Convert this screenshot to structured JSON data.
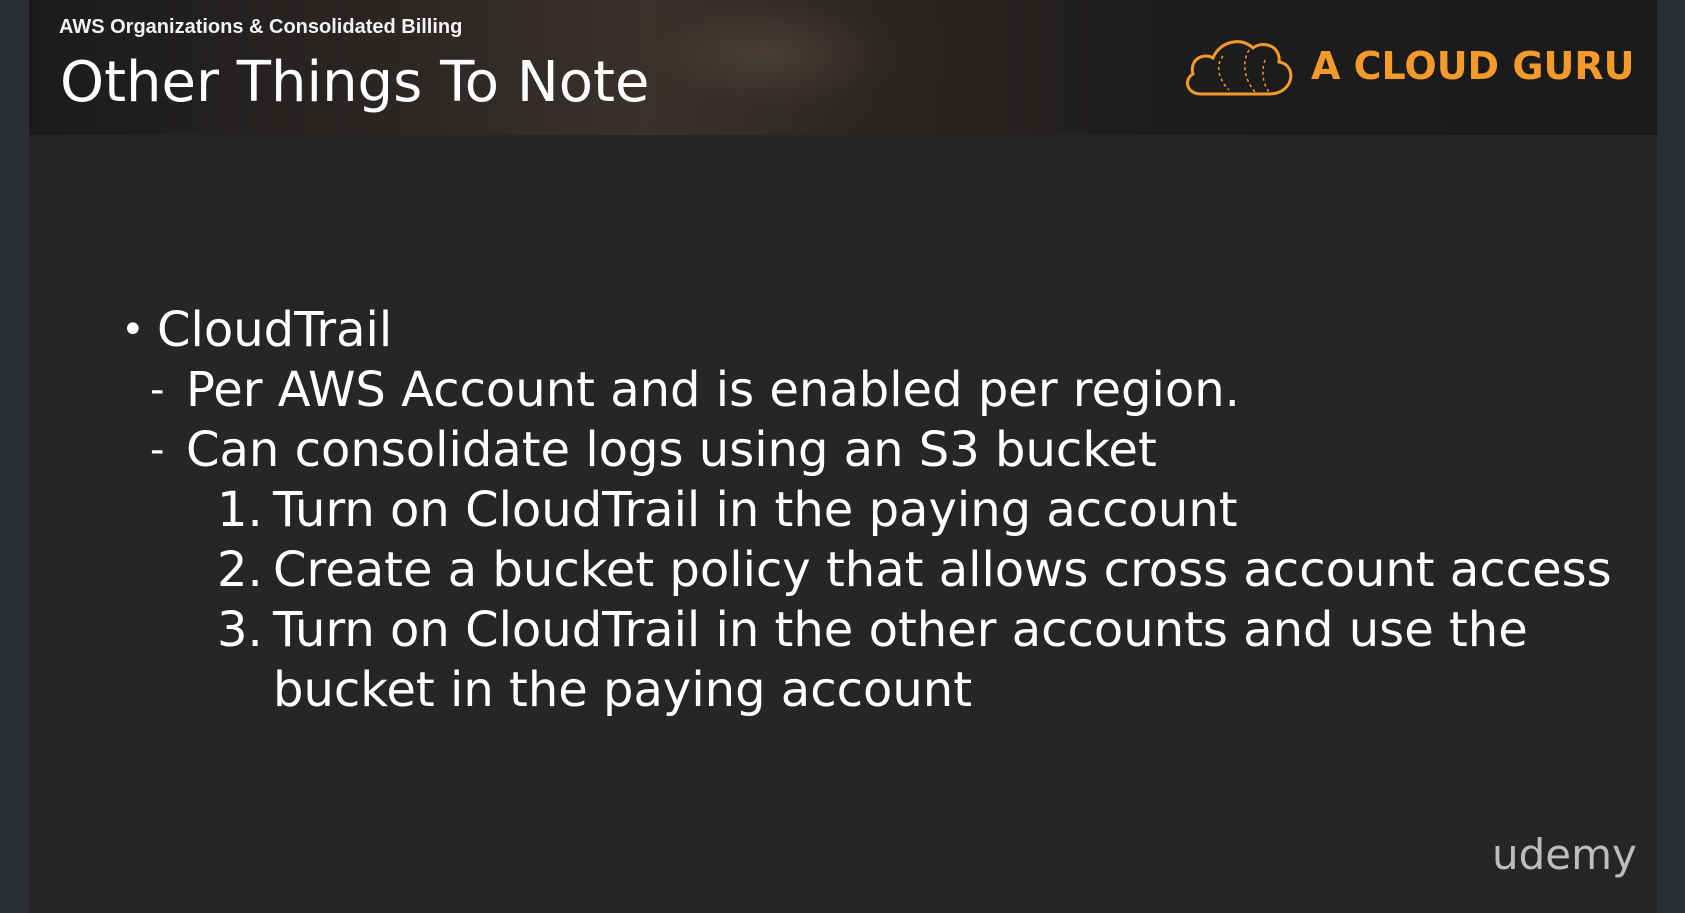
{
  "header": {
    "subtitle": "AWS Organizations & Consolidated Billing",
    "title": "Other Things To Note",
    "logo_text": "A CLOUD GURU",
    "logo_icon": "cloud-icon",
    "logo_color": "#f49a2a"
  },
  "body": {
    "bullet_marker": "•",
    "bullet": "CloudTrail",
    "dash_marker": "-",
    "sub_items": [
      "Per AWS Account and is enabled per region.",
      "Can consolidate logs using an S3 bucket"
    ],
    "steps": [
      {
        "num": "1.",
        "text": "Turn on CloudTrail in the paying account"
      },
      {
        "num": "2.",
        "text": "Create a bucket policy that allows cross account access"
      },
      {
        "num": "3.",
        "text": "Turn on CloudTrail in the other accounts and use the",
        "continuation": "bucket in the paying account"
      }
    ]
  },
  "watermark": "udemy",
  "colors": {
    "background": "#262626",
    "text": "#ffffff",
    "accent": "#f49a2a"
  }
}
